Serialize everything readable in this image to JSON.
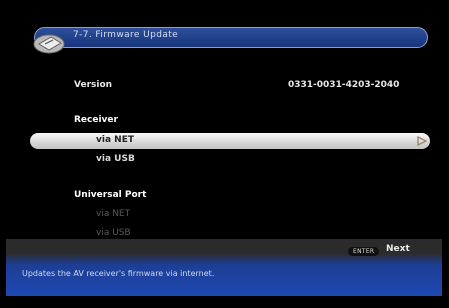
{
  "title_bar": {
    "title": "7-7.  Firmware Update",
    "icon": "tool-icon"
  },
  "version": {
    "label": "Version",
    "value": "0331-0031-4203-2040"
  },
  "receiver": {
    "label": "Receiver",
    "items": [
      {
        "label": "via  NET",
        "selected": true,
        "arrow_icon": "right-arrow-icon"
      },
      {
        "label": "via  USB",
        "selected": false
      }
    ]
  },
  "universal_port": {
    "label": "Universal  Port",
    "items": [
      {
        "label": "via  NET",
        "disabled": true
      },
      {
        "label": "via  USB",
        "disabled": true
      }
    ]
  },
  "footer": {
    "enter_badge": "ENTER",
    "next_label": "Next",
    "help_text": "Updates  the  AV  receiver's  firmware  via  internet."
  },
  "colors": {
    "title_bar": "#1f3f8c",
    "selection": "#e0e0e0",
    "footer": "#1f49b1"
  }
}
